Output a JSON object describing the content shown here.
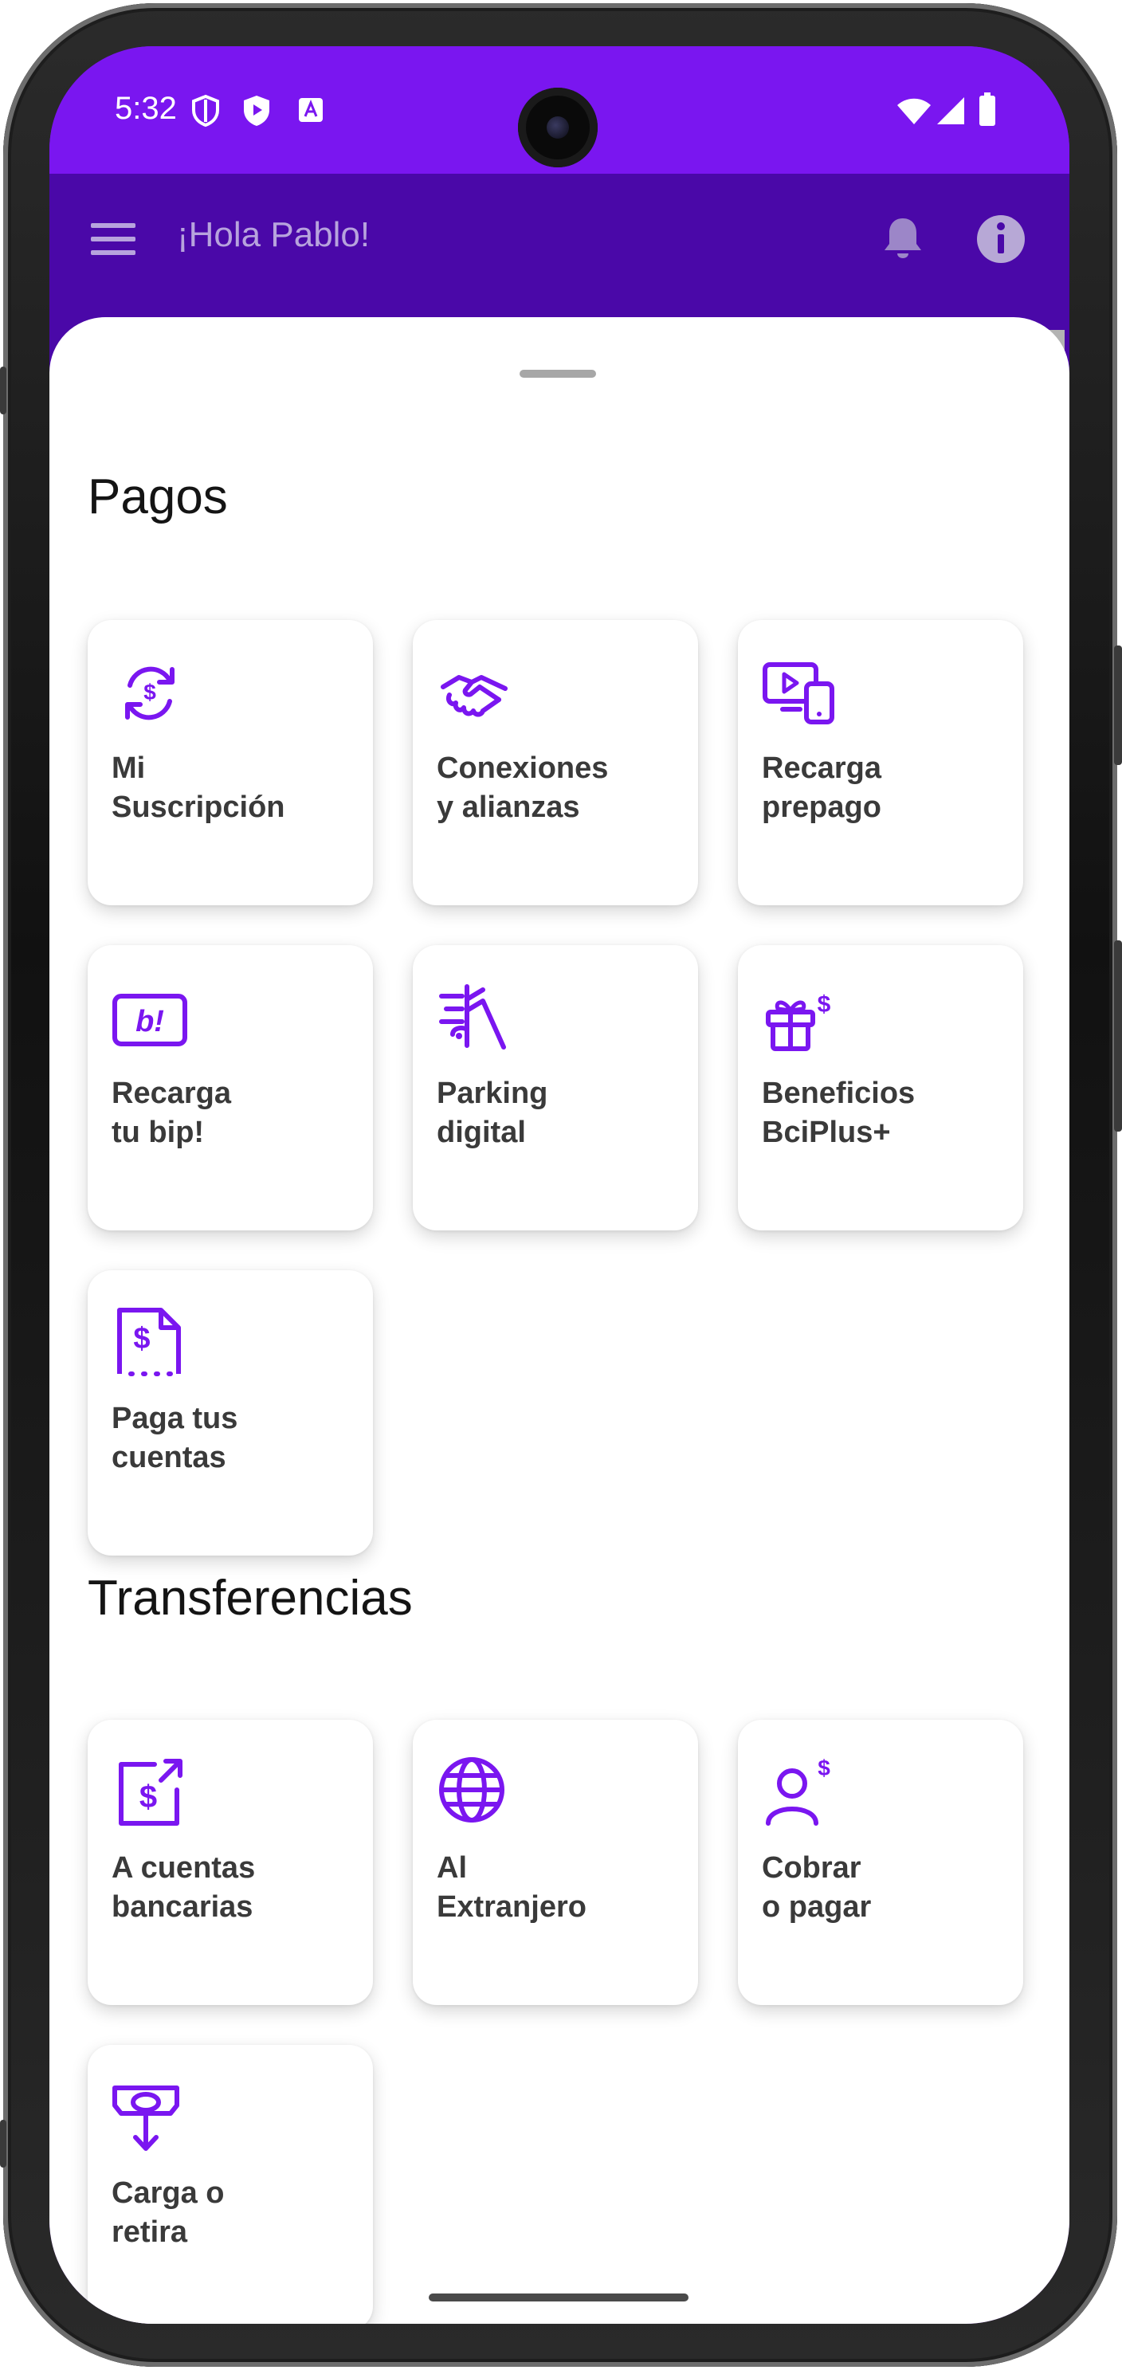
{
  "status_bar": {
    "time": "5:32"
  },
  "header": {
    "greeting": "¡Hola Pablo!"
  },
  "sections": {
    "pagos": {
      "title": "Pagos",
      "tiles": [
        {
          "label": "Mi\nSuscripción",
          "icon": "subscription-dollar-icon"
        },
        {
          "label": "Conexiones\ny alianzas",
          "icon": "handshake-icon"
        },
        {
          "label": "Recarga\nprepago",
          "icon": "devices-play-icon"
        },
        {
          "label": "Recarga\ntu bip!",
          "icon": "bip-card-icon"
        },
        {
          "label": "Parking\ndigital",
          "icon": "parking-car-icon"
        },
        {
          "label": "Beneficios\nBciPlus+",
          "icon": "gift-icon"
        },
        {
          "label": "Paga tus\ncuentas",
          "icon": "bill-receipt-icon"
        }
      ]
    },
    "transferencias": {
      "title": "Transferencias",
      "tiles": [
        {
          "label": "A cuentas\nbancarias",
          "icon": "bank-transfer-icon"
        },
        {
          "label": "Al\nExtranjero",
          "icon": "globe-icon"
        },
        {
          "label": "Cobrar\n o pagar",
          "icon": "person-dollar-icon"
        },
        {
          "label": "Carga o\nretira",
          "icon": "cash-withdraw-icon"
        }
      ]
    }
  },
  "colors": {
    "accent": "#7a16f0",
    "header": "#4a08a8",
    "tile_text": "#3a3a3a"
  }
}
